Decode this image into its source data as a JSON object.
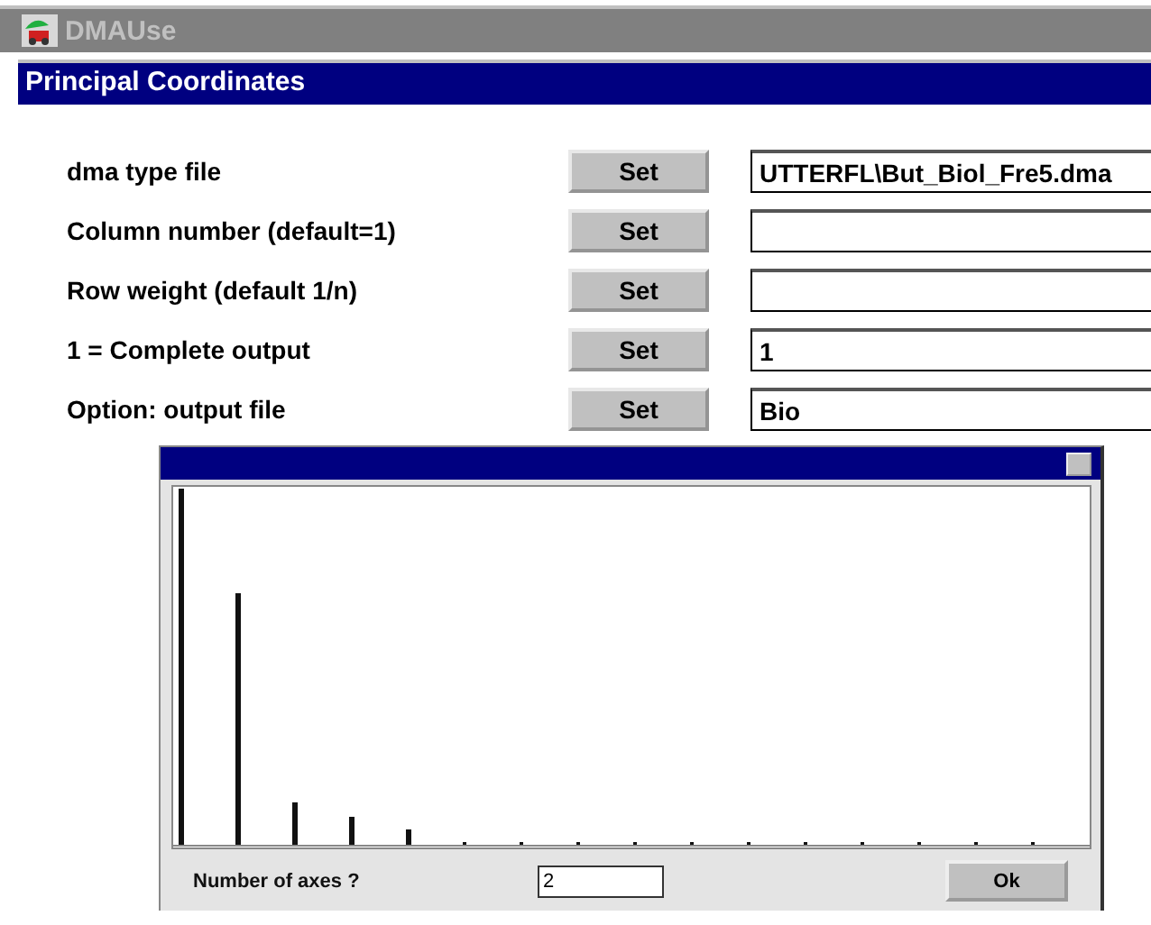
{
  "window": {
    "title": "DMAUse"
  },
  "panel": {
    "title": "Principal Coordinates"
  },
  "parameters": [
    {
      "label": "dma type file",
      "button": "Set",
      "value": "UTTERFL\\But_Biol_Fre5.dma"
    },
    {
      "label": "Column number (default=1)",
      "button": "Set"
    },
    {
      "label": "Row weight (default 1/n)",
      "button": "Set"
    },
    {
      "label": "1 = Complete output",
      "button": "Set",
      "value": "1"
    },
    {
      "label": "Option: output file",
      "button": "Set",
      "value": "Bio"
    }
  ],
  "dialog": {
    "prompt": "Number of axes ?",
    "value": "2",
    "button": "Ok"
  }
}
